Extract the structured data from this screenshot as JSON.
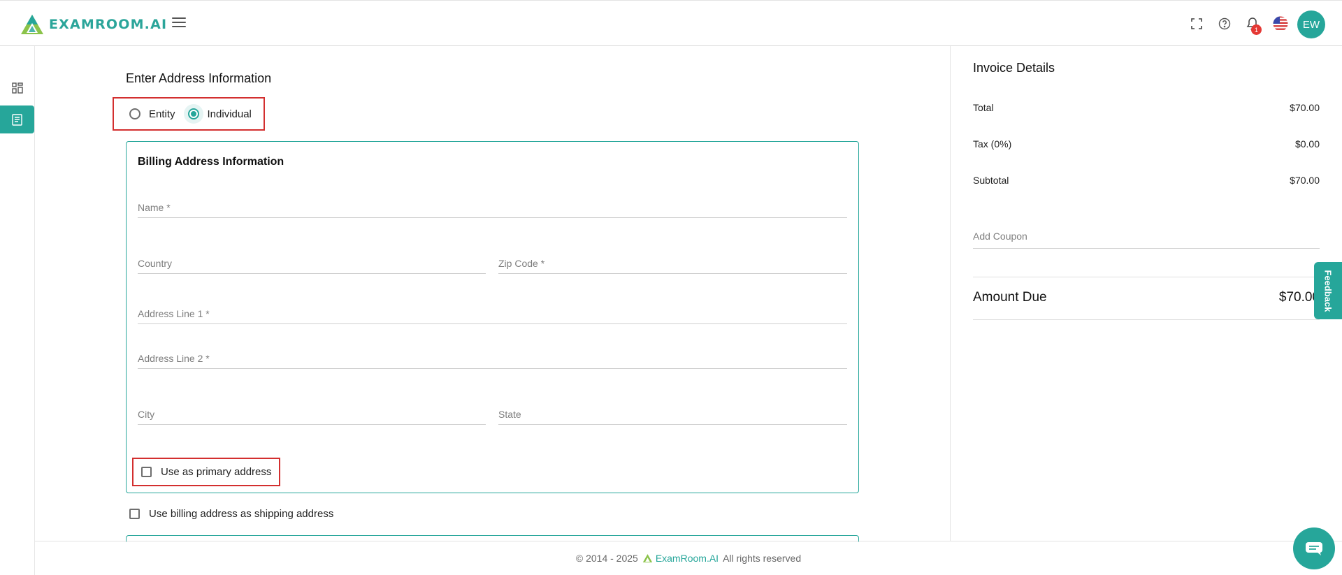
{
  "header": {
    "brand": "EXAMROOM.AI",
    "notification_count": "1",
    "avatar_initials": "EW"
  },
  "icons": {
    "logo": "examroom-triangle-logo",
    "menu": "hamburger-icon",
    "fullscreen": "fullscreen-icon",
    "help": "help-circle-icon",
    "notifications": "bell-icon",
    "language": "us-flag-icon",
    "dashboard": "dashboard-grid-icon",
    "document": "document-icon",
    "chat": "chat-bubble-icon"
  },
  "colors": {
    "accent": "#26a69a",
    "highlight_border": "#d32f2f",
    "badge": "#e53935"
  },
  "main": {
    "section_title": "Enter Address Information",
    "radio_options": [
      {
        "label": "Entity",
        "selected": false
      },
      {
        "label": "Individual",
        "selected": true
      }
    ],
    "billing": {
      "title": "Billing Address Information",
      "name_placeholder": "Name *",
      "country_placeholder": "Country",
      "zip_placeholder": "Zip Code *",
      "address1_placeholder": "Address Line 1 *",
      "address2_placeholder": "Address Line 2 *",
      "city_placeholder": "City",
      "state_placeholder": "State",
      "primary_checkbox_label": "Use as primary address"
    },
    "shipping_checkbox_label": "Use billing address as shipping address"
  },
  "invoice": {
    "title": "Invoice Details",
    "rows": [
      {
        "label": "Total",
        "value": "$70.00"
      },
      {
        "label": "Tax (0%)",
        "value": "$0.00"
      },
      {
        "label": "Subtotal",
        "value": "$70.00"
      }
    ],
    "coupon_placeholder": "Add Coupon",
    "amount_due_label": "Amount Due",
    "amount_due_value": "$70.00"
  },
  "feedback_label": "Feedback",
  "footer": {
    "copyright": "© 2014 - 2025",
    "brand": "ExamRoom.AI",
    "rights": "All rights reserved"
  }
}
